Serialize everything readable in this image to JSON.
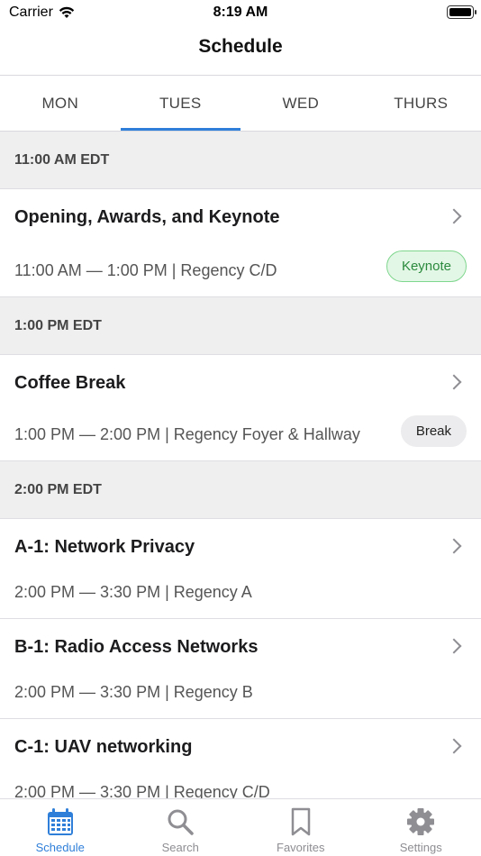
{
  "status_bar": {
    "carrier": "Carrier",
    "time": "8:19 AM"
  },
  "nav": {
    "title": "Schedule"
  },
  "day_tabs": [
    {
      "label": "MON"
    },
    {
      "label": "TUES"
    },
    {
      "label": "WED"
    },
    {
      "label": "THURS"
    }
  ],
  "active_day": "TUES",
  "sections": [
    {
      "header": "11:00 AM EDT",
      "items": [
        {
          "title": "Opening, Awards, and Keynote",
          "subtitle": "11:00 AM — 1:00 PM | Regency C/D",
          "badge": "Keynote"
        }
      ]
    },
    {
      "header": "1:00 PM EDT",
      "items": [
        {
          "title": "Coffee Break",
          "subtitle": "1:00 PM — 2:00 PM | Regency Foyer & Hallway",
          "badge": "Break"
        }
      ]
    },
    {
      "header": "2:00 PM EDT",
      "items": [
        {
          "title": "A-1: Network Privacy",
          "subtitle": "2:00 PM — 3:30 PM | Regency A"
        },
        {
          "title": "B-1: Radio Access Networks",
          "subtitle": "2:00 PM — 3:30 PM | Regency B"
        },
        {
          "title": "C-1: UAV networking",
          "subtitle": "2:00 PM — 3:30 PM | Regency C/D"
        }
      ]
    }
  ],
  "tab_bar": [
    {
      "label": "Schedule",
      "icon": "calendar-icon"
    },
    {
      "label": "Search",
      "icon": "search-icon"
    },
    {
      "label": "Favorites",
      "icon": "bookmark-icon"
    },
    {
      "label": "Settings",
      "icon": "gear-icon"
    }
  ],
  "colors": {
    "accent": "#2f7fd9",
    "keynote_badge": "#e3f7e6",
    "break_badge": "#ececee"
  }
}
